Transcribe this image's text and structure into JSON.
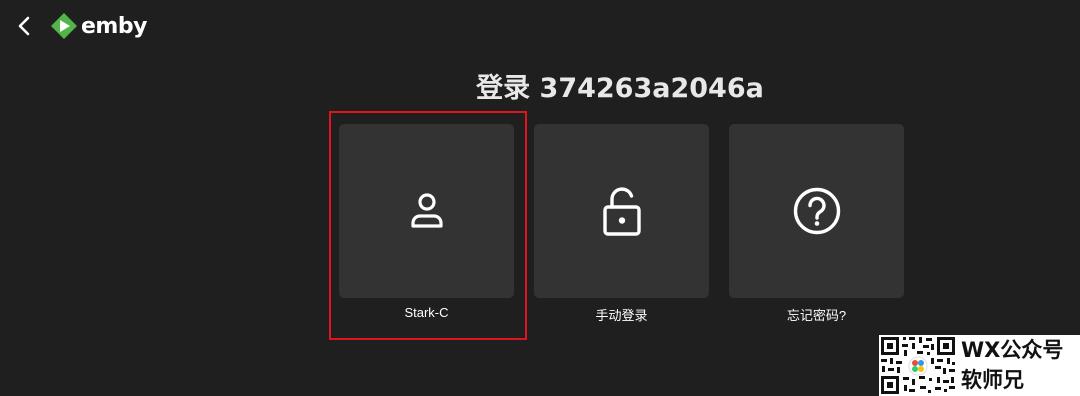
{
  "header": {
    "back_icon": "chevron-left-icon",
    "logo_text": "emby",
    "logo_color": "#52b54b"
  },
  "main": {
    "title": "登录 374263a2046a",
    "cards": [
      {
        "label": "Stark-C",
        "icon": "user-icon"
      },
      {
        "label": "手动登录",
        "icon": "unlock-icon"
      },
      {
        "label": "忘记密码?",
        "icon": "help-circle-icon"
      }
    ],
    "highlight_color": "#e0141e"
  },
  "watermark": {
    "line1": "WX公众号",
    "line2": "软师兄",
    "qr_icon": "qr-code-icon"
  }
}
